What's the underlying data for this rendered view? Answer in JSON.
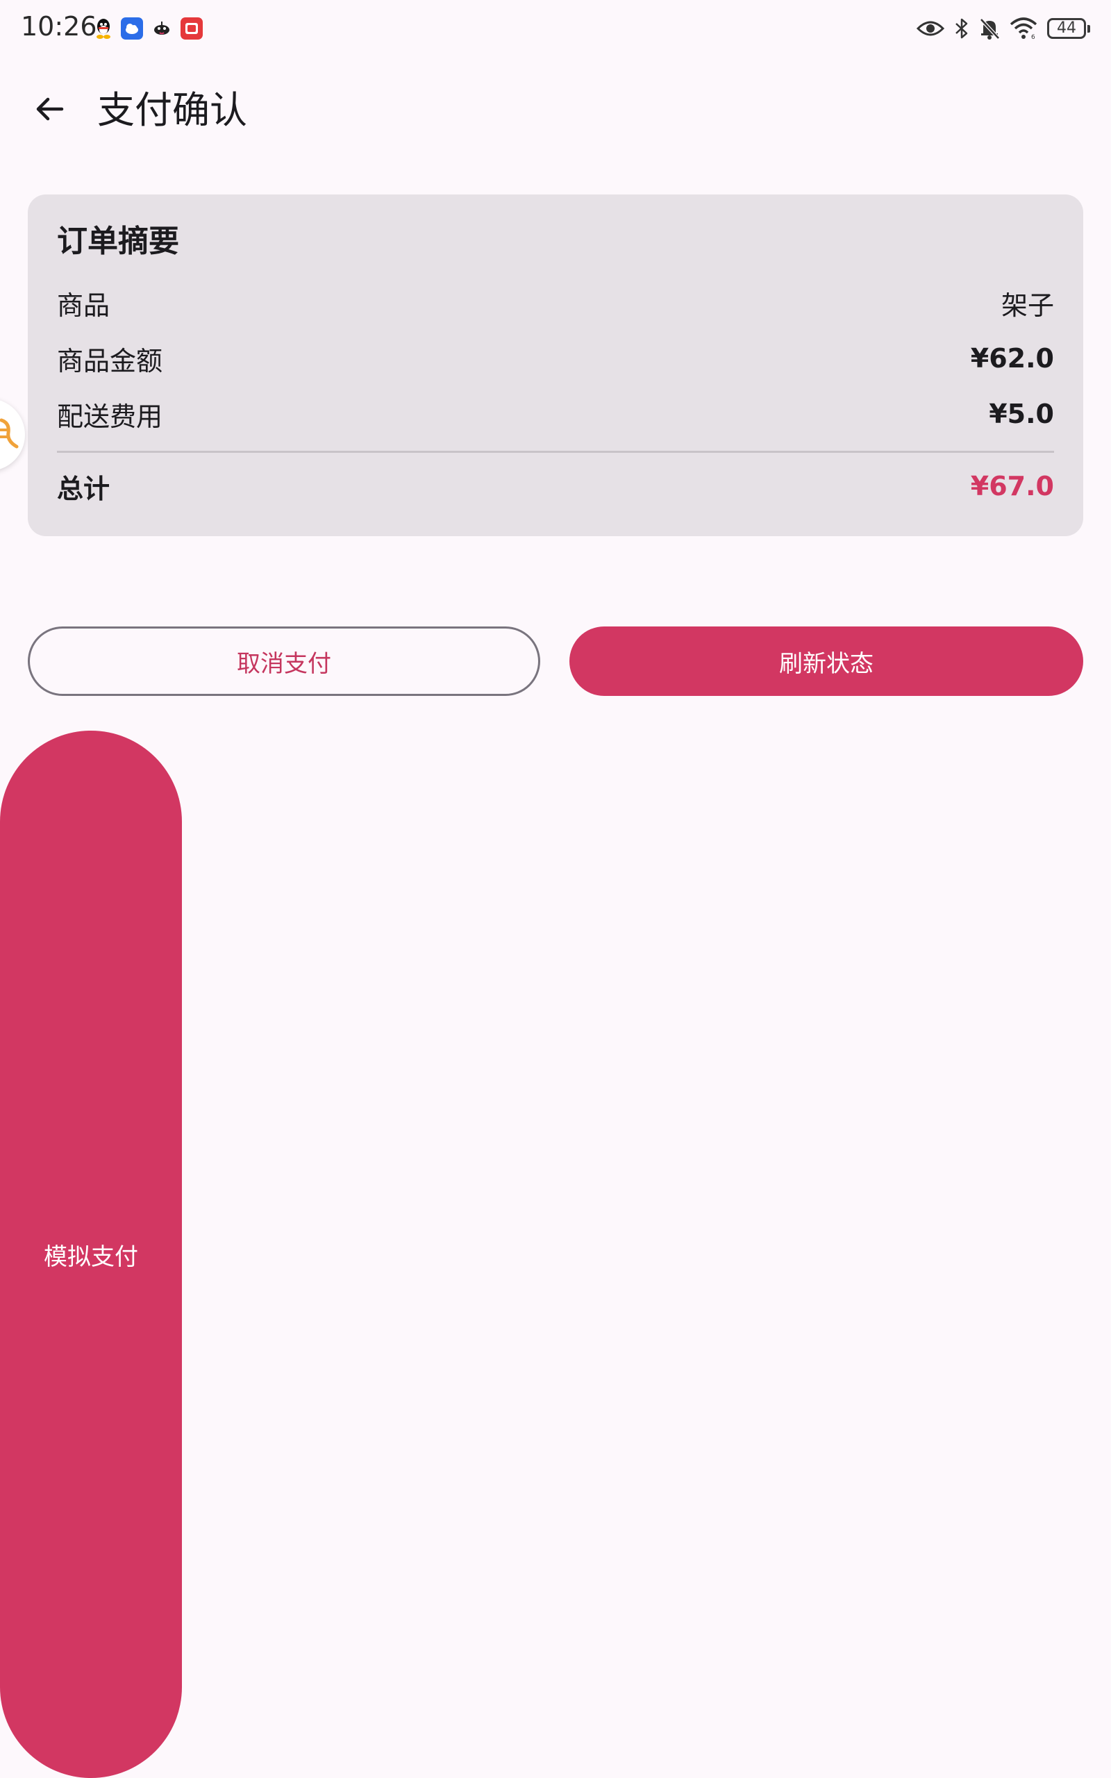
{
  "status_bar": {
    "time": "10:26",
    "battery": "44"
  },
  "app_bar": {
    "title": "支付确认"
  },
  "order_summary": {
    "title": "订单摘要",
    "rows": [
      {
        "label": "商品",
        "value": "架子"
      },
      {
        "label": "商品金额",
        "value": "¥62.0"
      },
      {
        "label": "配送费用",
        "value": "¥5.0"
      }
    ],
    "total": {
      "label": "总计",
      "value": "¥67.0"
    }
  },
  "buttons": {
    "cancel": "取消支付",
    "refresh": "刷新状态",
    "simulate": "模拟支付"
  },
  "colors": {
    "accent": "#d23762",
    "background": "#fdf8fc",
    "card": "#e6e1e6"
  },
  "icons": {
    "back": "arrow-back-icon",
    "notifications": [
      "qq-icon",
      "cloud-app-icon",
      "bird-app-icon",
      "red-app-icon"
    ],
    "system": [
      "eye-icon",
      "bluetooth-icon",
      "bell-off-icon",
      "wifi-icon",
      "battery-icon"
    ]
  }
}
